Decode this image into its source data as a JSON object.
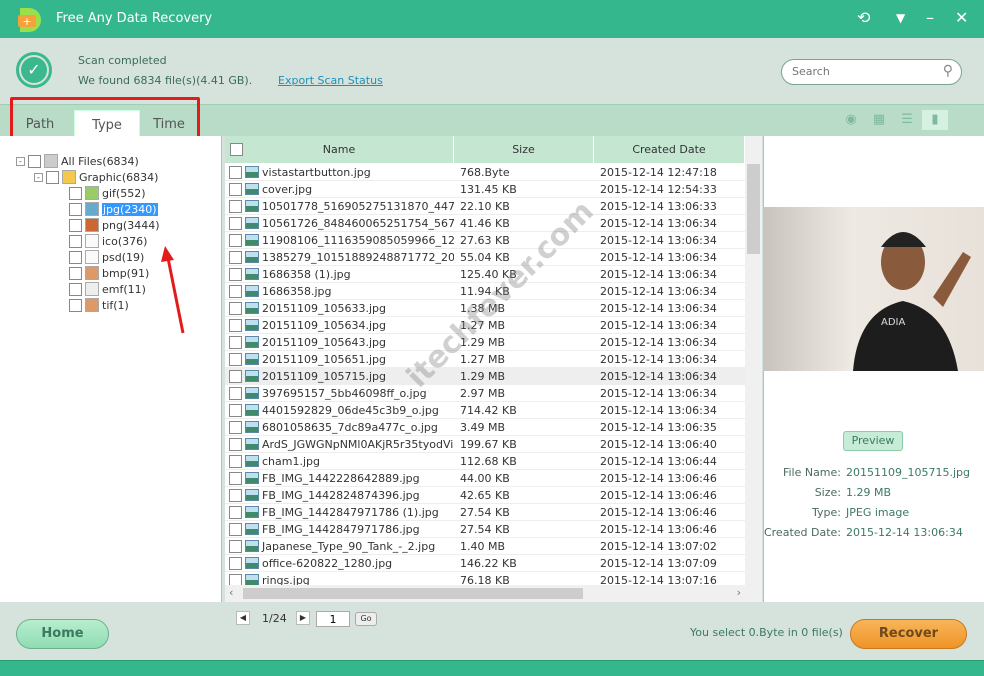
{
  "app": {
    "title": "Free Any Data Recovery"
  },
  "header": {
    "status": "Scan completed",
    "found": "We found 6834 file(s)(4.41 GB).",
    "export_link": "Export Scan Status",
    "search_placeholder": "Search"
  },
  "tabs": [
    {
      "label": "Path"
    },
    {
      "label": "Type",
      "active": true
    },
    {
      "label": "Time"
    }
  ],
  "view_buttons": [
    "eye-icon",
    "grid-icon",
    "list-icon",
    "detail-pane-icon"
  ],
  "tree": [
    {
      "label": "All Files(6834)",
      "icon": "drive-icon"
    },
    {
      "label": "Graphic(6834)",
      "icon": "folder-icon"
    },
    {
      "label": "gif(552)",
      "icon": "gif-icon"
    },
    {
      "label": "jpg(2340)",
      "icon": "jpg-icon",
      "selected": true
    },
    {
      "label": "png(3444)",
      "icon": "png-icon"
    },
    {
      "label": "ico(376)",
      "icon": "file-icon"
    },
    {
      "label": "psd(19)",
      "icon": "file-icon"
    },
    {
      "label": "bmp(91)",
      "icon": "bmp-icon"
    },
    {
      "label": "emf(11)",
      "icon": "emf-icon"
    },
    {
      "label": "tif(1)",
      "icon": "tif-icon"
    }
  ],
  "table": {
    "columns": [
      "Name",
      "Size",
      "Created Date"
    ],
    "rows": [
      [
        "vistastartbutton.jpg",
        "768.Byte",
        "2015-12-14 12:47:18"
      ],
      [
        "cover.jpg",
        "131.45 KB",
        "2015-12-14 12:54:33"
      ],
      [
        "10501778_516905275131870_4471...",
        "22.10 KB",
        "2015-12-14 13:06:33"
      ],
      [
        "10561726_848460065251754_5677...",
        "41.46 KB",
        "2015-12-14 13:06:34"
      ],
      [
        "11908106_1116359085059966_128...",
        "27.63 KB",
        "2015-12-14 13:06:34"
      ],
      [
        "1385279_10151889248871772_200...",
        "55.04 KB",
        "2015-12-14 13:06:34"
      ],
      [
        "1686358 (1).jpg",
        "125.40 KB",
        "2015-12-14 13:06:34"
      ],
      [
        "1686358.jpg",
        "11.94 KB",
        "2015-12-14 13:06:34"
      ],
      [
        "20151109_105633.jpg",
        "1.38 MB",
        "2015-12-14 13:06:34"
      ],
      [
        "20151109_105634.jpg",
        "1.27 MB",
        "2015-12-14 13:06:34"
      ],
      [
        "20151109_105643.jpg",
        "1.29 MB",
        "2015-12-14 13:06:34"
      ],
      [
        "20151109_105651.jpg",
        "1.27 MB",
        "2015-12-14 13:06:34"
      ],
      [
        "20151109_105715.jpg",
        "1.29 MB",
        "2015-12-14 13:06:34"
      ],
      [
        "397695157_5bb46098ff_o.jpg",
        "2.97 MB",
        "2015-12-14 13:06:34"
      ],
      [
        "4401592829_06de45c3b9_o.jpg",
        "714.42 KB",
        "2015-12-14 13:06:34"
      ],
      [
        "6801058635_7dc89a477c_o.jpg",
        "3.49 MB",
        "2015-12-14 13:06:35"
      ],
      [
        "ArdS_JGWGNpNMl0AKjR5r35tyodVia...",
        "199.67 KB",
        "2015-12-14 13:06:40"
      ],
      [
        "cham1.jpg",
        "112.68 KB",
        "2015-12-14 13:06:44"
      ],
      [
        "FB_IMG_1442228642889.jpg",
        "44.00 KB",
        "2015-12-14 13:06:46"
      ],
      [
        "FB_IMG_1442824874396.jpg",
        "42.65 KB",
        "2015-12-14 13:06:46"
      ],
      [
        "FB_IMG_1442847971786 (1).jpg",
        "27.54 KB",
        "2015-12-14 13:06:46"
      ],
      [
        "FB_IMG_1442847971786.jpg",
        "27.54 KB",
        "2015-12-14 13:06:46"
      ],
      [
        "Japanese_Type_90_Tank_-_2.jpg",
        "1.40 MB",
        "2015-12-14 13:07:02"
      ],
      [
        "office-620822_1280.jpg",
        "146.22 KB",
        "2015-12-14 13:07:09"
      ],
      [
        "rings.jpg",
        "76.18 KB",
        "2015-12-14 13:07:16"
      ]
    ],
    "highlighted_row": 12
  },
  "preview": {
    "button": "Preview",
    "labels": [
      "File Name:",
      "Size:",
      "Type:",
      "Created Date:"
    ],
    "values": [
      "20151109_105715.jpg",
      "1.29 MB",
      "JPEG image",
      "2015-12-14 13:06:34"
    ]
  },
  "pagination": {
    "info": "1/24",
    "page": "1",
    "go": "Go"
  },
  "footer": {
    "home": "Home",
    "selection": "You select 0.Byte in 0 file(s)",
    "recover": "Recover"
  },
  "watermark": "itechfever.com",
  "colors": {
    "brand": "#35b78d",
    "accent_orange": "#ee9427",
    "selection": "#3399ff",
    "annotation": "#e31b1b"
  }
}
